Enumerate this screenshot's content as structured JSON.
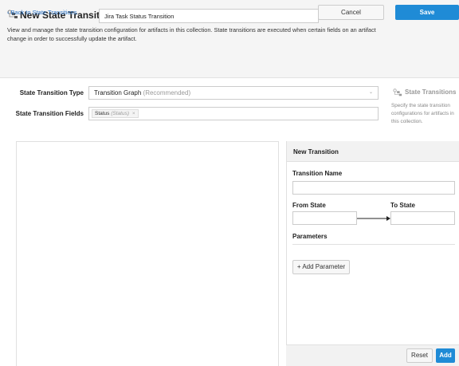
{
  "header": {
    "icon": "state-transition-icon",
    "title": "New State Transition",
    "name_value": "Jira Task Status Transition",
    "description": "View and manage the state transition configuration for artifacts in this collection. State transitions are executed when certain fields on an artifact change in order to successfully update the artifact."
  },
  "actionbar": {
    "back_label": "Back to State Transitions",
    "cancel_label": "Cancel",
    "save_label": "Save",
    "accent": "#1f8bd6"
  },
  "form": {
    "type_label": "State Transition Type",
    "type_value": "Transition Graph",
    "type_hint": "(Recommended)",
    "fields_label": "State Transition Fields",
    "field_tags": [
      {
        "label": "Status",
        "hint": "(Status)"
      }
    ]
  },
  "sidebar": {
    "icon": "state-transition-icon",
    "title": "State Transitions",
    "description": "Specify the state transition configurations for artifacts in this collection."
  },
  "panel": {
    "title": "New Transition",
    "name_label": "Transition Name",
    "from_label": "From State",
    "to_label": "To State",
    "params_label": "Parameters",
    "add_param_label": "+ Add Parameter",
    "reset_label": "Reset",
    "add_label": "Add"
  }
}
